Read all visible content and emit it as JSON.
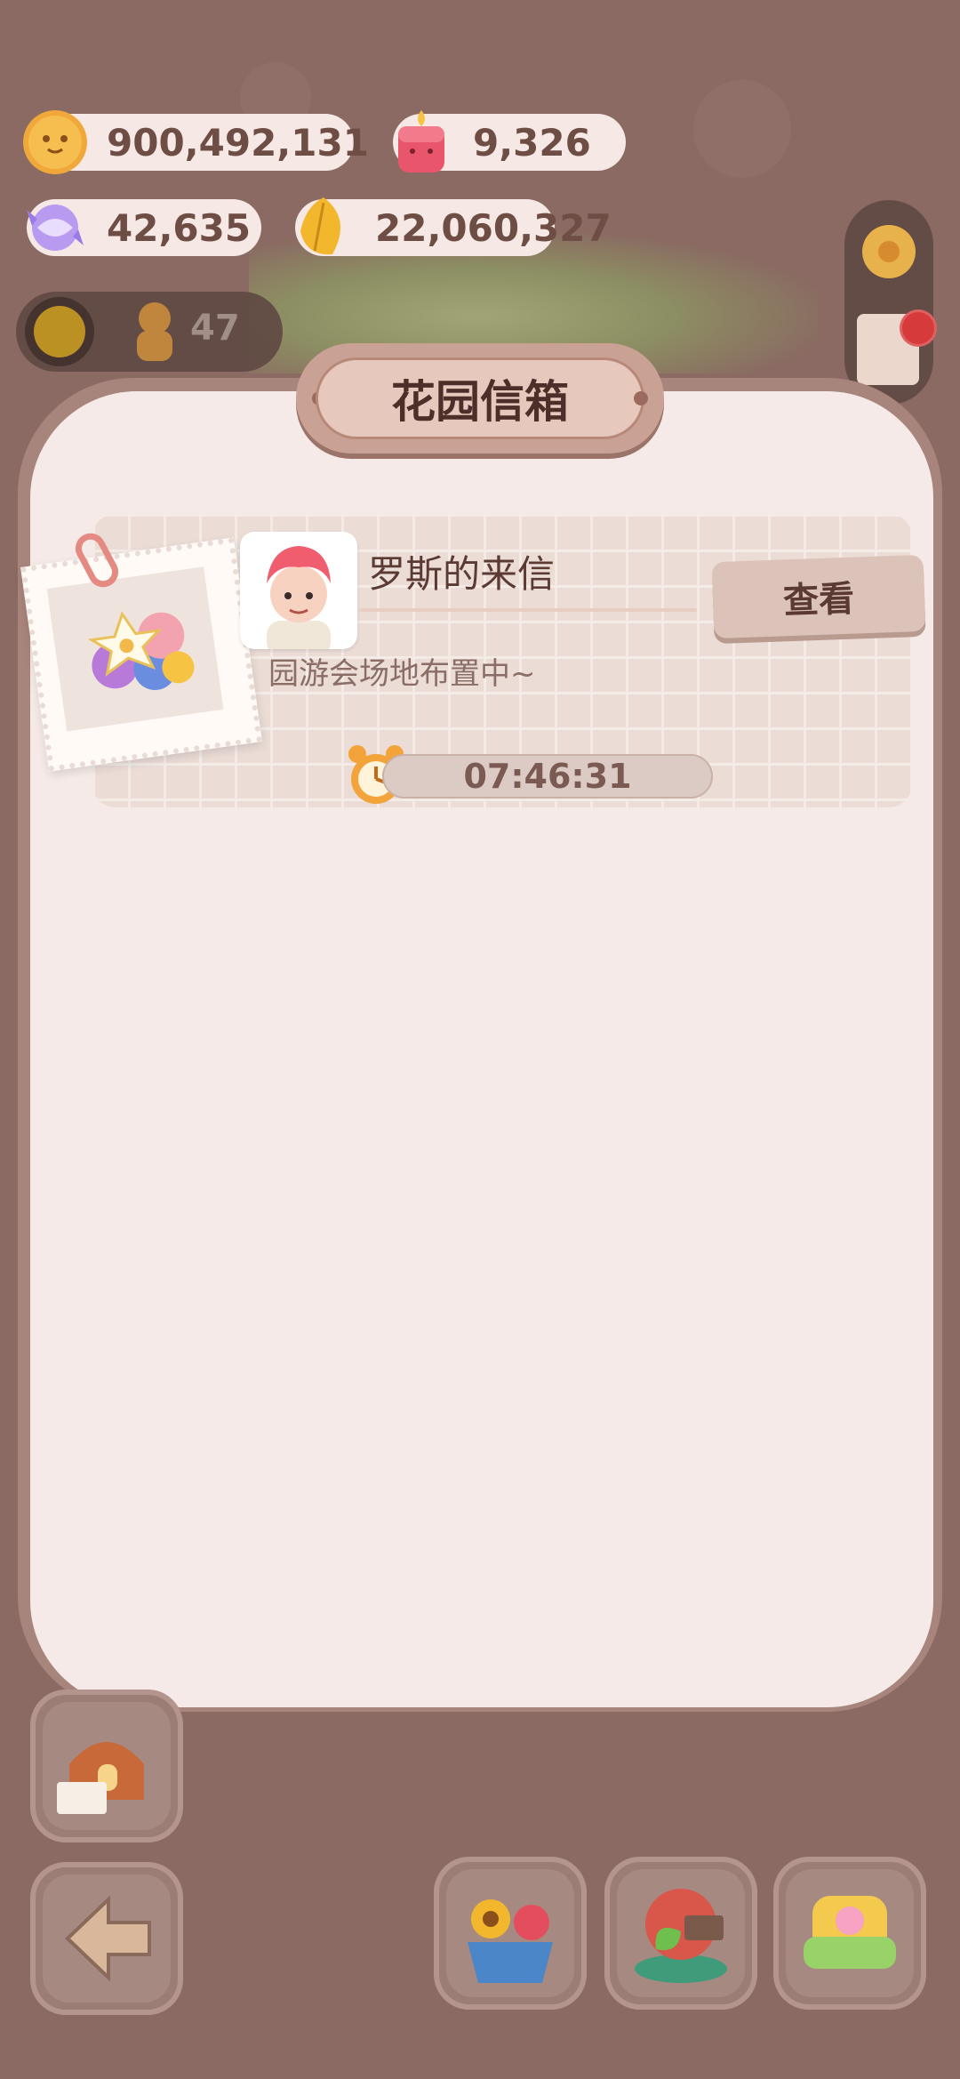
{
  "currencies": {
    "coins": "900,492,131",
    "gems": "9,326",
    "candy": "42,635",
    "leaves": "22,060,327"
  },
  "player": {
    "level_count": "47"
  },
  "mailbox": {
    "title": "花园信箱",
    "letters": [
      {
        "sender": "罗斯的来信",
        "message": "园游会场地布置中~",
        "view_label": "查看",
        "timer": "07:46:31"
      }
    ]
  },
  "colors": {
    "background": "#8a6a62",
    "panel": "#f5eae7",
    "title_plate": "#caa195",
    "accent_red": "#d63a3a"
  }
}
